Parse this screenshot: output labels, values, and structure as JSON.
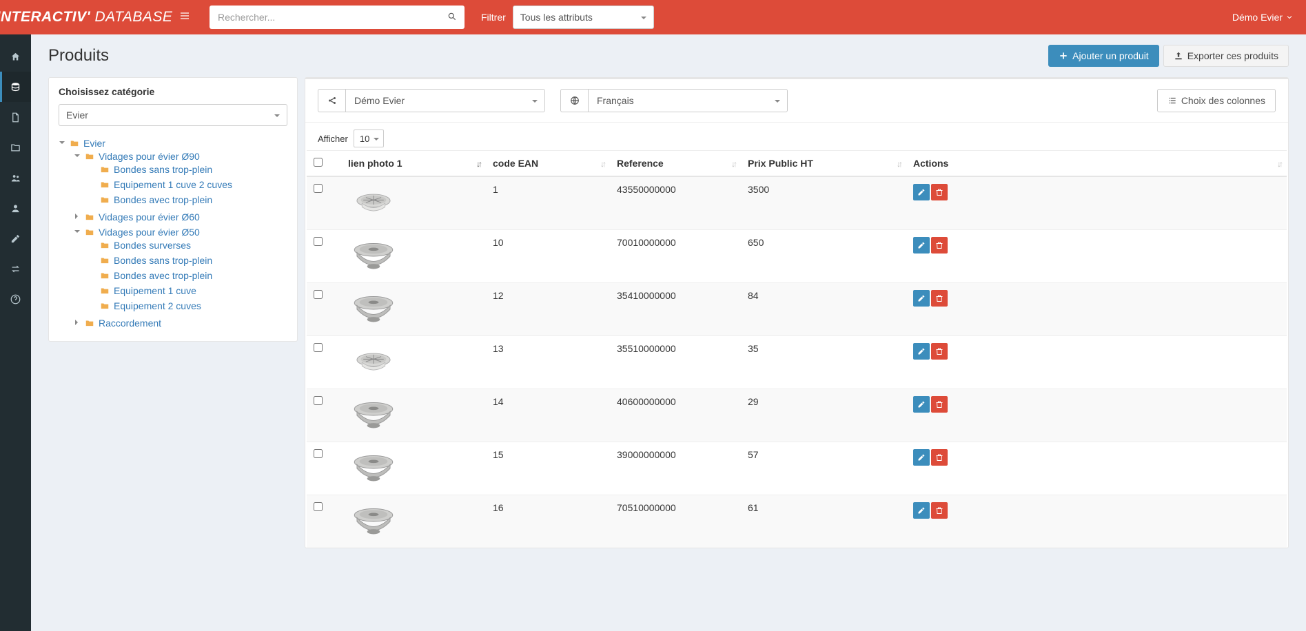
{
  "brand": {
    "part1": "INTERACTIV'",
    "part2": "DATABASE"
  },
  "topbar": {
    "search_placeholder": "Rechercher...",
    "filter_label": "Filtrer",
    "filter_value": "Tous les attributs",
    "user": "Démo Evier"
  },
  "page": {
    "title": "Produits",
    "add_button": "Ajouter un produit",
    "export_button": "Exporter ces produits"
  },
  "category_panel": {
    "title": "Choisissez catégorie",
    "select_value": "Evier",
    "tree": {
      "root": "Evier",
      "v90": "Vidages pour évier Ø90",
      "v90_children": [
        "Bondes sans trop-plein",
        "Equipement 1 cuve 2 cuves",
        "Bondes avec trop-plein"
      ],
      "v60": "Vidages pour évier Ø60",
      "v50": "Vidages pour évier Ø50",
      "v50_children": [
        "Bondes surverses",
        "Bondes sans trop-plein",
        "Bondes avec trop-plein",
        "Equipement 1 cuve",
        "Equipement 2 cuves"
      ],
      "raccord": "Raccordement"
    }
  },
  "toolbar": {
    "share_value": "Démo Evier",
    "lang_value": "Français",
    "columns_button": "Choix des colonnes"
  },
  "table": {
    "show_label": "Afficher",
    "page_size": "10",
    "columns": {
      "photo": "lien photo 1",
      "ean": "code EAN",
      "ref": "Reference",
      "price": "Prix Public HT",
      "actions": "Actions"
    },
    "rows": [
      {
        "ean": "1",
        "ref": "43550000000",
        "price": "3500",
        "style": "flat"
      },
      {
        "ean": "10",
        "ref": "70010000000",
        "price": "650",
        "style": "basket"
      },
      {
        "ean": "12",
        "ref": "35410000000",
        "price": "84",
        "style": "basket"
      },
      {
        "ean": "13",
        "ref": "35510000000",
        "price": "35",
        "style": "flat"
      },
      {
        "ean": "14",
        "ref": "40600000000",
        "price": "29",
        "style": "basket"
      },
      {
        "ean": "15",
        "ref": "39000000000",
        "price": "57",
        "style": "basket"
      },
      {
        "ean": "16",
        "ref": "70510000000",
        "price": "61",
        "style": "basket"
      }
    ]
  }
}
